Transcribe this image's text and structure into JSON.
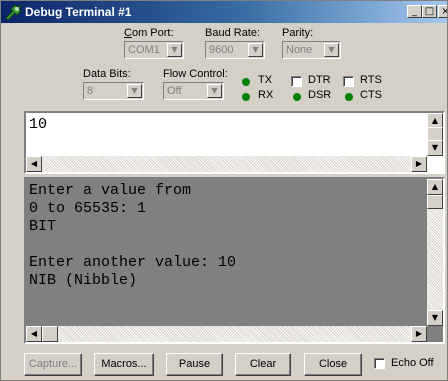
{
  "window": {
    "title": "Debug Terminal #1"
  },
  "settings": {
    "com_port": {
      "label": "Com Port:",
      "value": "COM1"
    },
    "baud_rate": {
      "label": "Baud Rate:",
      "value": "9600"
    },
    "parity": {
      "label": "Parity:",
      "value": "None"
    },
    "data_bits": {
      "label": "Data Bits:",
      "value": "8"
    },
    "flow_control": {
      "label": "Flow Control:",
      "value": "Off"
    }
  },
  "indicators": {
    "tx": "TX",
    "rx": "RX",
    "dtr": "DTR",
    "dsr": "DSR",
    "rts": "RTS",
    "cts": "CTS",
    "led_color": "#008000"
  },
  "transmit_pane": {
    "text": "10"
  },
  "receive_pane": {
    "text": "Enter a value from\n0 to 65535: 1\nBIT\n\nEnter another value: 10\nNIB (Nibble)",
    "background": "#808080"
  },
  "buttons": {
    "capture": "Capture...",
    "macros": "Macros...",
    "pause": "Pause",
    "clear": "Clear",
    "close": "Close",
    "echo_off": "Echo Off"
  }
}
